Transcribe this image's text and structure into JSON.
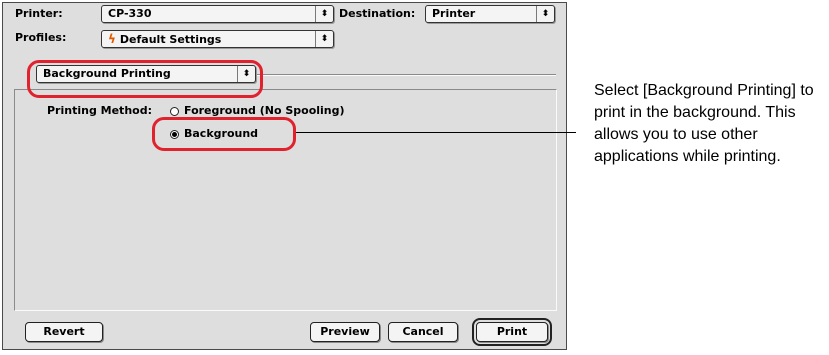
{
  "header": {
    "printer_label": "Printer:",
    "printer_value": "CP-330",
    "destination_label": "Destination:",
    "destination_value": "Printer",
    "profiles_label": "Profiles:",
    "profiles_value": "Default Settings"
  },
  "panel_selector": {
    "value": "Background Printing"
  },
  "printing_method": {
    "label": "Printing Method:",
    "options": [
      {
        "label": "Foreground (No Spooling)",
        "selected": false
      },
      {
        "label": "Background",
        "selected": true
      }
    ]
  },
  "buttons": {
    "revert": "Revert",
    "preview": "Preview",
    "cancel": "Cancel",
    "print": "Print"
  },
  "annotation": {
    "text": "Select [Background Printing] to print in the background. This allows you to use other applications while printing.",
    "color": "#e0222e"
  },
  "icons": {
    "popup_arrows": "updown-arrows-icon",
    "profile": "flame-icon"
  }
}
